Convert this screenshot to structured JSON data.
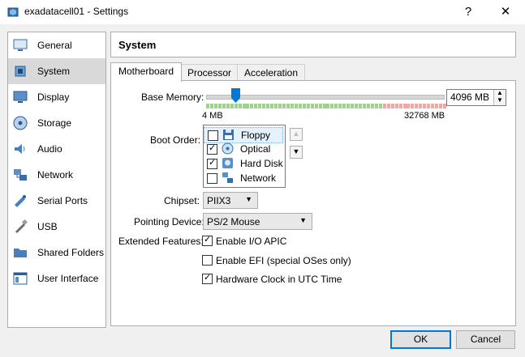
{
  "window": {
    "title": "exadatacell01 - Settings",
    "help_glyph": "?",
    "close_glyph": "✕"
  },
  "sidebar": {
    "items": [
      {
        "label": "General",
        "icon": "general-icon"
      },
      {
        "label": "System",
        "icon": "system-icon",
        "selected": true
      },
      {
        "label": "Display",
        "icon": "display-icon"
      },
      {
        "label": "Storage",
        "icon": "storage-icon"
      },
      {
        "label": "Audio",
        "icon": "audio-icon"
      },
      {
        "label": "Network",
        "icon": "network-icon"
      },
      {
        "label": "Serial Ports",
        "icon": "serial-ports-icon"
      },
      {
        "label": "USB",
        "icon": "usb-icon"
      },
      {
        "label": "Shared Folders",
        "icon": "shared-folders-icon"
      },
      {
        "label": "User Interface",
        "icon": "user-interface-icon"
      }
    ]
  },
  "header": {
    "title": "System"
  },
  "tabs": [
    {
      "label": "Motherboard",
      "active": true
    },
    {
      "label": "Processor"
    },
    {
      "label": "Acceleration"
    }
  ],
  "motherboard": {
    "base_memory_label": "Base Memory:",
    "base_memory_value": "4096 MB",
    "memory_min": "4 MB",
    "memory_max": "32768 MB",
    "memory_fraction": 0.125,
    "boot_order_label": "Boot Order:",
    "boot_items": [
      {
        "label": "Floppy",
        "checked": false,
        "icon": "floppy-icon"
      },
      {
        "label": "Optical",
        "checked": true,
        "icon": "optical-disc-icon"
      },
      {
        "label": "Hard Disk",
        "checked": true,
        "icon": "hard-disk-icon"
      },
      {
        "label": "Network",
        "checked": false,
        "icon": "network-icon"
      }
    ],
    "chipset_label": "Chipset:",
    "chipset_value": "PIIX3",
    "pointing_label": "Pointing Device:",
    "pointing_value": "PS/2 Mouse",
    "ext_label": "Extended Features:",
    "features": [
      {
        "label": "Enable I/O APIC",
        "checked": true
      },
      {
        "label": "Enable EFI (special OSes only)",
        "checked": false
      },
      {
        "label": "Hardware Clock in UTC Time",
        "checked": true
      }
    ]
  },
  "buttons": {
    "ok": "OK",
    "cancel": "Cancel"
  },
  "colors": {
    "accent": "#0078d7",
    "slider_green": "#9bd48a",
    "slider_red": "#f0a8a0",
    "selected_bg": "#d9d9d9"
  }
}
